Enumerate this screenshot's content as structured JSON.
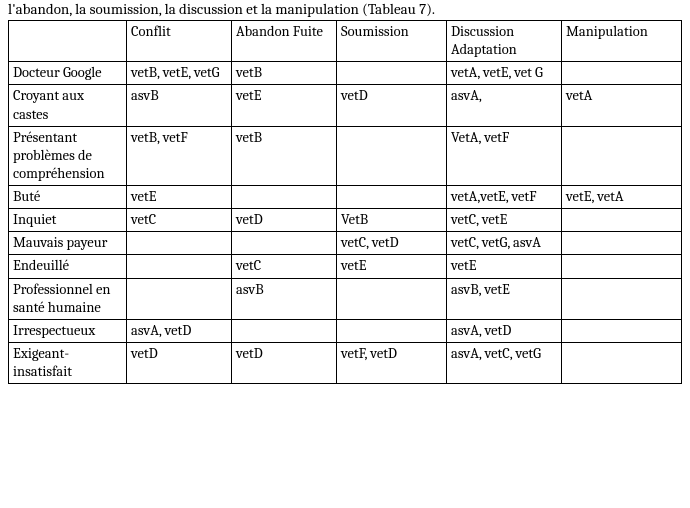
{
  "intro": "l'abandon, la soumission, la discussion et la manipulation (Tableau 7).",
  "table": {
    "headers": {
      "c0": "",
      "c1": "Conflit",
      "c2": "Abandon Fuite",
      "c3": "Soumission",
      "c4": "Discussion Adaptation",
      "c5": "Manipulation"
    },
    "rows": [
      {
        "label": "Docteur Google",
        "c1": "vetB, vetE, vetG",
        "c2": "vetB",
        "c3": "",
        "c4": "vetA, vetE, vet G",
        "c5": ""
      },
      {
        "label": "Croyant aux castes",
        "c1": "asvB",
        "c2": "vetE",
        "c3": "vetD",
        "c4": "asvA,",
        "c5": "vetA"
      },
      {
        "label": "Présentant problèmes de compréhension",
        "c1": "vetB, vetF",
        "c2": "vetB",
        "c3": "",
        "c4": "VetA, vetF",
        "c5": ""
      },
      {
        "label": "Buté",
        "c1": "vetE",
        "c2": "",
        "c3": "",
        "c4": "vetA,vetE, vetF",
        "c5": "vetE, vetA"
      },
      {
        "label": "Inquiet",
        "c1": "vetC",
        "c2": "vetD",
        "c3": "VetB",
        "c4": "vetC, vetE",
        "c5": ""
      },
      {
        "label": "Mauvais payeur",
        "c1": "",
        "c2": "",
        "c3": "vetC, vetD",
        "c4": "vetC, vetG, asvA",
        "c5": ""
      },
      {
        "label": "Endeuillé",
        "c1": "",
        "c2": "vetC",
        "c3": "vetE",
        "c4": "vetE",
        "c5": ""
      },
      {
        "label": "Professionnel en santé humaine",
        "c1": "",
        "c2": "asvB",
        "c3": "",
        "c4": "asvB, vetE",
        "c5": ""
      },
      {
        "label": "Irrespectueux",
        "c1": "asvA, vetD",
        "c2": "",
        "c3": "",
        "c4": "asvA, vetD",
        "c5": ""
      },
      {
        "label": "Exigeant-insatisfait",
        "c1": "vetD",
        "c2": "vetD",
        "c3": "vetF, vetD",
        "c4": "asvA, vetC, vetG",
        "c5": ""
      }
    ]
  }
}
